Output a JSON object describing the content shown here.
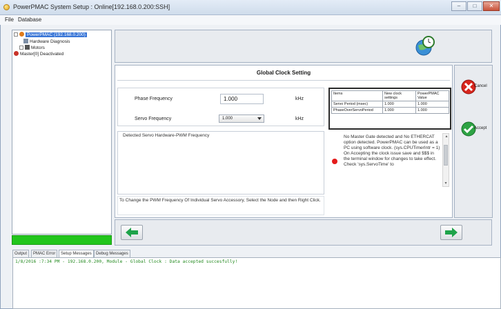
{
  "window": {
    "title": "PowerPMAC System Setup : Online[192.168.0.200:SSH]",
    "buttons": {
      "minimize": "–",
      "maximize": "□",
      "close": "✕"
    }
  },
  "menu": {
    "items": [
      "File",
      "Database"
    ]
  },
  "tree": {
    "root": "PowerPMAC (192.168.0.200)",
    "children": [
      "Hardware Diagnosis",
      "Motors"
    ],
    "master": "Master[0] Deactivated"
  },
  "main": {
    "heading": "Global Clock Setting",
    "phase": {
      "label": "Phase Frequency",
      "value": "1.000",
      "unit": "kHz"
    },
    "servo": {
      "label": "Servo Frequency",
      "value": "1.000",
      "unit": "kHz"
    },
    "detect_legend": "Detected Servo Hardware-PWM Frequency",
    "change_note": "To Change the PWM Frequency Of Individual Servo Accessory, Select the Node and then Right Click.",
    "table": {
      "headers": [
        "Items",
        "New clock settings",
        "PowerPMAC Value"
      ],
      "rows": [
        [
          "Servo Period (msec)",
          "1.000",
          "1.000"
        ],
        [
          "PhaseOverServoPeriod",
          "1.000",
          "1.000"
        ]
      ]
    },
    "message": "No Master Gate detected and No ETHERCAT option detected. PowerPMAC can be used as a PC using software clock. (sys.CPUTimerIntr = 1) On Accepting the clock issue save and $$$ in the terminal window for changes to take effect. Check 'sys.ServoTime' to"
  },
  "side": {
    "cancel": "Cancel",
    "accept": "Accept"
  },
  "tabs": [
    "Output",
    "PMAC Error",
    "Setup Messages",
    "Debug Messages"
  ],
  "active_tab": "Setup Messages",
  "output_line": "1/8/2016 :7:34 PM - 192.168.0.200, Module - Global Clock : Data accepted succesfully!",
  "colors": {
    "status_green": "#22c61c",
    "nav_arrow": "#1ea34a",
    "cancel_red": "#d8261d",
    "accept_green": "#2ea344"
  }
}
